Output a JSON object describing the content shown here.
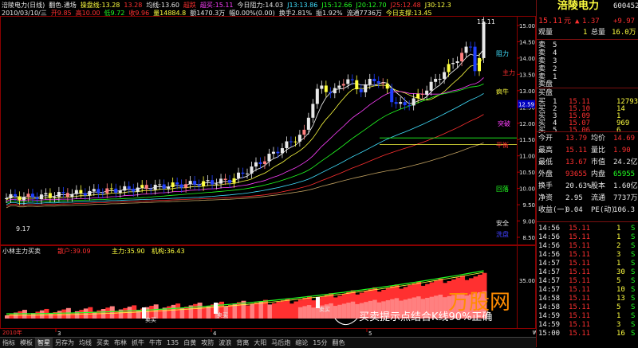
{
  "header": {
    "row1": [
      {
        "text": "涪陵电力(日线)",
        "color": "#e8e8e8"
      },
      {
        "text": "翻色.通场",
        "color": "#e8e8e8"
      },
      {
        "text": "操盘线:13.28",
        "color": "#ffff40"
      },
      {
        "text": "13.28",
        "color": "#ff3030"
      },
      {
        "text": "均线:13.60",
        "color": "#e8e8e8"
      },
      {
        "text": "超跌",
        "color": "#ff3030"
      },
      {
        "text": "超买:15.11",
        "color": "#ff40ff"
      },
      {
        "text": "今日阻力:14.03",
        "color": "#e8e8e8"
      },
      {
        "text": "J13:13.86",
        "color": "#40e0ff"
      },
      {
        "text": "J15:12.66",
        "color": "#22ff22"
      },
      {
        "text": "J20:12.70",
        "color": "#22ff22"
      },
      {
        "text": "J25:12.48",
        "color": "#ff3030"
      },
      {
        "text": "J30:12.3",
        "color": "#ffff40"
      }
    ],
    "row2": [
      {
        "text": "2010/03/10/三",
        "color": "#e8e8e8"
      },
      {
        "text": "开9.85",
        "color": "#ff3030"
      },
      {
        "text": "高10.00",
        "color": "#ff3030"
      },
      {
        "text": "低9.72",
        "color": "#22ff22"
      },
      {
        "text": "收9.96",
        "color": "#ff3030"
      },
      {
        "text": "量14884.8",
        "color": "#ffff40"
      },
      {
        "text": "额1470.3万",
        "color": "#e8e8e8"
      },
      {
        "text": "幅0.00%(0.00)",
        "color": "#e8e8e8"
      },
      {
        "text": "换手2.81%",
        "color": "#e8e8e8"
      },
      {
        "text": "振1.92%",
        "color": "#e8e8e8"
      },
      {
        "text": "流通7736万",
        "color": "#e8e8e8"
      },
      {
        "text": "今日支撑:13.45",
        "color": "#ffff40"
      }
    ]
  },
  "price_axis": [
    "15.00",
    "14.50",
    "14.00",
    "13.50",
    "13.00",
    "12.50",
    "12.00",
    "11.50",
    "11.00",
    "10.50",
    "10.00",
    "9.50",
    "9.00",
    "8.50"
  ],
  "price_label_box": "12.59",
  "annotations": [
    {
      "text": "15.11",
      "color": "#e8e8e8"
    },
    {
      "text": "阻力",
      "color": "#40e0ff"
    },
    {
      "text": "主力",
      "color": "#ff3030"
    },
    {
      "text": "疯牛",
      "color": "#ffff40"
    },
    {
      "text": "突破",
      "color": "#ff40ff"
    },
    {
      "text": "平衡",
      "color": "#ff3030"
    },
    {
      "text": "回落",
      "color": "#22ff22"
    },
    {
      "text": "安全",
      "color": "#e8e8e8"
    },
    {
      "text": "洗盘",
      "color": "#4040ff"
    },
    {
      "text": "9.17",
      "color": "#e8e8e8"
    }
  ],
  "indicator": {
    "title": "小林主力买卖",
    "retail_label": "散户:39.09",
    "main_label": "主力:35.90",
    "inst_label": "机构:36.43",
    "axis_value": "35.00",
    "buy_marks": [
      "卖买",
      "卖买",
      "卖买"
    ],
    "caption": "买卖提示点结合K线90%正确"
  },
  "bottom_axis": {
    "year": "2010年",
    "marks": [
      "3",
      "4",
      "5"
    ]
  },
  "tabs": [
    "指标",
    "模板",
    "智星",
    "另存为",
    "均线",
    "买卖",
    "布林",
    "抓牛",
    "牛市",
    "135",
    "白黄",
    "攻防",
    "波浪",
    "背离",
    "大阳",
    "马后炮",
    "缩论",
    "15分",
    "翻色"
  ],
  "active_tab": "智星",
  "watermark": {
    "text": "万股网",
    "url": "www.201082.com"
  },
  "quote": {
    "name": "涪陵电力",
    "code": "600452",
    "price": "15.11",
    "price_unit": "元",
    "change": "1.37",
    "change_pct": "+9.97",
    "weibi_label": "委比",
    "weibi_val": "—",
    "liangbi_label": "观量",
    "liangbi_val": "1",
    "total_label": "总量",
    "total_val": "16.0万",
    "asks": [
      {
        "label": "5",
        "price": "",
        "vol": ""
      },
      {
        "label": "4",
        "price": "",
        "vol": ""
      },
      {
        "label": "3",
        "price": "",
        "vol": ""
      },
      {
        "label": "2",
        "price": "",
        "vol": ""
      },
      {
        "label": "1",
        "price": "",
        "vol": ""
      }
    ],
    "ask_title": "卖盘",
    "bid_title": "买盘",
    "bids": [
      {
        "label": "1",
        "price": "15.11",
        "vol": "12793"
      },
      {
        "label": "2",
        "price": "15.10",
        "vol": "14"
      },
      {
        "label": "3",
        "price": "15.09",
        "vol": "1"
      },
      {
        "label": "4",
        "price": "15.07",
        "vol": "969"
      },
      {
        "label": "5",
        "price": "15.06",
        "vol": "6"
      }
    ],
    "stats": [
      {
        "l1": "今开",
        "v1": "13.79",
        "c1": "#ff3030",
        "l2": "均价",
        "v2": "14.69",
        "c2": "#ff3030"
      },
      {
        "l1": "最高",
        "v1": "15.11",
        "c1": "#ff3030",
        "l2": "量比",
        "v2": "1.90",
        "c2": "#ff3030"
      },
      {
        "l1": "最低",
        "v1": "13.67",
        "c1": "#ff3030",
        "l2": "市值",
        "v2": "24.2亿",
        "c2": "#e8e8e8"
      },
      {
        "l1": "外盘",
        "v1": "93655",
        "c1": "#ff3030",
        "l2": "内盘",
        "v2": "65955",
        "c2": "#22ff22"
      },
      {
        "l1": "换手",
        "v1": "20.63%",
        "c1": "#e8e8e8",
        "l2": "股本",
        "v2": "1.60亿",
        "c2": "#e8e8e8"
      },
      {
        "l1": "净资",
        "v1": "2.95",
        "c1": "#e8e8e8",
        "l2": "流通",
        "v2": "7737万",
        "c2": "#e8e8e8"
      },
      {
        "l1": "收益(一)",
        "v1": "0.04",
        "c1": "#e8e8e8",
        "l2": "PE(动)",
        "v2": "106.3",
        "c2": "#e8e8e8"
      }
    ],
    "ticks": [
      {
        "t": "14:56",
        "p": "15.11",
        "v": "1",
        "s": "S"
      },
      {
        "t": "14:56",
        "p": "15.11",
        "v": "1",
        "s": "S"
      },
      {
        "t": "14:56",
        "p": "15.11",
        "v": "2",
        "s": "S"
      },
      {
        "t": "14:56",
        "p": "15.11",
        "v": "3",
        "s": "S"
      },
      {
        "t": "14:57",
        "p": "15.11",
        "v": "1",
        "s": "S"
      },
      {
        "t": "14:57",
        "p": "15.11",
        "v": "30",
        "s": "S"
      },
      {
        "t": "14:57",
        "p": "15.11",
        "v": "5",
        "s": "S"
      },
      {
        "t": "14:57",
        "p": "15.11",
        "v": "10",
        "s": "S"
      },
      {
        "t": "14:58",
        "p": "15.11",
        "v": "13",
        "s": "S"
      },
      {
        "t": "14:58",
        "p": "15.11",
        "v": "5",
        "s": "S"
      },
      {
        "t": "14:59",
        "p": "15.11",
        "v": "1",
        "s": "S"
      },
      {
        "t": "14:59",
        "p": "15.11",
        "v": "3",
        "s": "S"
      },
      {
        "t": "15:00",
        "p": "15.11",
        "v": "16",
        "s": "S"
      }
    ]
  },
  "colors": {
    "up": "#ff3030",
    "down": "#22ff22",
    "yellow": "#ffff40",
    "white": "#e8e8e8",
    "blue": "#2040ff",
    "pink": "#ff8080",
    "grid": "#8b0000"
  }
}
